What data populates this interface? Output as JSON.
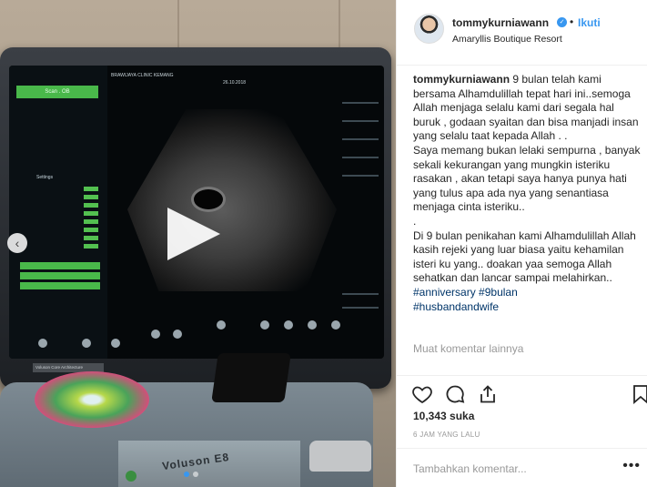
{
  "header": {
    "username": "tommykurniawann",
    "separator": "•",
    "follow_label": "Ikuti",
    "location": "Amaryllis Boutique Resort",
    "verified_icon": "verified-badge-icon"
  },
  "caption": {
    "username": "tommykurniawann",
    "paragraph1": "9 bulan telah kami bersama Alhamdulillah tepat hari ini..semoga Allah menjaga selalu kami dari segala hal buruk , godaan syaitan dan bisa manjadi insan yang selalu taat kepada Allah . .",
    "paragraph2": "Saya memang bukan lelaki sempurna , banyak sekali kekurangan yang mungkin isteriku rasakan , akan tetapi saya hanya punya hati yang tulus apa ada nya yang senantiasa menjaga cinta isteriku..",
    "paragraph3": ".",
    "paragraph4": "Di 9 bulan penikahan kami Alhamdulillah Allah kasih rejeki yang luar biasa yaitu kehamilan isteri ku yang.. doakan yaa semoga Allah sehatkan dan lancar sampai melahirkan..",
    "hashtag1": "#anniversary",
    "hashtag2": "#9bulan",
    "hashtag3": "#husbandandwife"
  },
  "more_comments": "Muat komentar lainnya",
  "likes": "10,343 suka",
  "time_ago": "6 JAM YANG LALU",
  "comment": {
    "placeholder": "Tambahkan komentar...",
    "more": "•••"
  },
  "media": {
    "screen_tab": "Scan . OB",
    "settings_label": "Settings",
    "brand_tag": "Voluson Core Architecture",
    "machine_brand": "Voluson E8",
    "clinic": "BRAWIJAYA CLINIC KEMANG",
    "date": "26.10.2018"
  },
  "colors": {
    "accent": "#3897f0",
    "text": "#262626",
    "muted": "#999999",
    "border": "#efefef"
  }
}
